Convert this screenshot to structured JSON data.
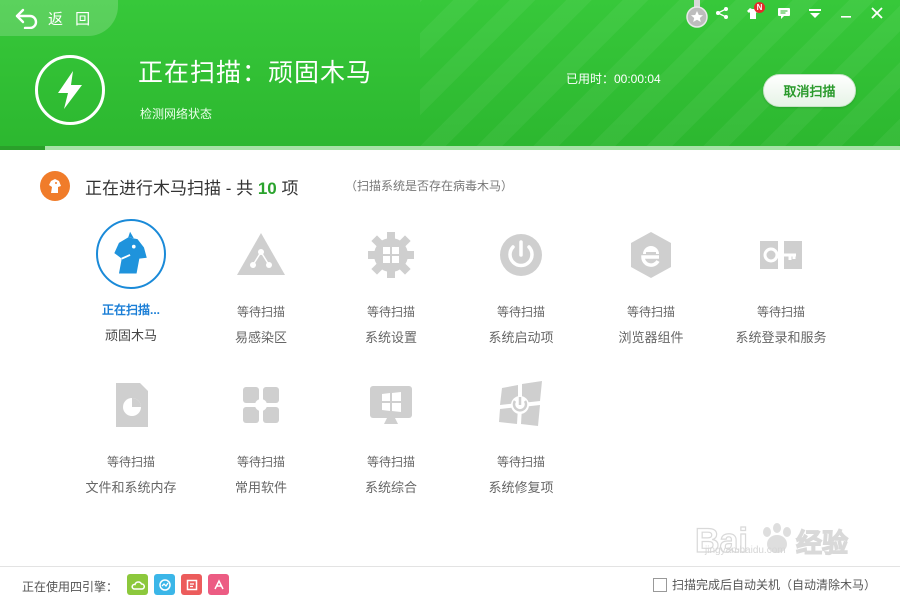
{
  "header": {
    "back_label": "返 回",
    "scan_title": "正在扫描：顽固木马",
    "scan_subtitle": "检测网络状态",
    "elapsed": "已用时：00:00:04",
    "cancel_label": "取消扫描",
    "notification_badge": "N",
    "colors": {
      "header_green": "#2cb72f",
      "progress": "#2aa02a"
    },
    "progress_fraction": 0.05
  },
  "section": {
    "title_prefix": "正在进行木马扫描 - 共",
    "count": "10",
    "title_suffix": "项",
    "hint": "（扫描系统是否存在病毒木马）"
  },
  "items": [
    {
      "status": "正在扫描...",
      "name": "顽固木马",
      "icon": "horse-icon",
      "active": true
    },
    {
      "status": "等待扫描",
      "name": "易感染区",
      "icon": "warning-triangle-icon"
    },
    {
      "status": "等待扫描",
      "name": "系统设置",
      "icon": "gear-windows-icon"
    },
    {
      "status": "等待扫描",
      "name": "系统启动项",
      "icon": "power-icon"
    },
    {
      "status": "等待扫描",
      "name": "浏览器组件",
      "icon": "ie-browser-icon"
    },
    {
      "status": "等待扫描",
      "name": "系统登录和服务",
      "icon": "key-service-icon"
    },
    {
      "status": "等待扫描",
      "name": "文件和系统内存",
      "icon": "file-pie-icon"
    },
    {
      "status": "等待扫描",
      "name": "常用软件",
      "icon": "puzzle-icon"
    },
    {
      "status": "等待扫描",
      "name": "系统综合",
      "icon": "monitor-windows-icon"
    },
    {
      "status": "等待扫描",
      "name": "系统修复项",
      "icon": "windows-repair-icon"
    }
  ],
  "footer": {
    "engines_label": "正在使用四引擎：",
    "engines": [
      "cloud-engine-icon",
      "qvm-engine-icon",
      "bitdefender-engine-icon",
      "avira-engine-icon"
    ],
    "engine_colors": [
      "#8cc83c",
      "#3bb6e8",
      "#ec5c5c",
      "#ec5c83"
    ],
    "auto_shutdown_label": "扫描完成后自动关机（自动清除木马）",
    "auto_shutdown_checked": false
  },
  "watermark": {
    "brand": "Bai du 经验",
    "url": "jingyan.baidu.com"
  }
}
